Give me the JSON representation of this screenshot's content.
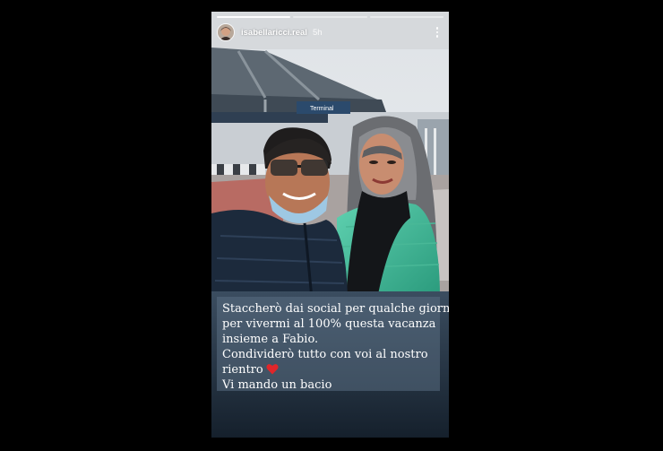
{
  "story": {
    "username": "isabellaricci.real",
    "age": "5h",
    "progress_segments": 3,
    "progress_active": 1,
    "sign_text": "Terminal",
    "caption": {
      "line1": "Staccherò dai social per qualche giorno",
      "line2": "per vivermi al 100% questa vacanza",
      "line3": "insieme a Fabio.",
      "line4": "Condividerò tutto con voi al nostro",
      "line5": "rientro",
      "line6": "Vi mando un bacio"
    },
    "icons": {
      "more": "more-vertical-icon",
      "heart": "red-heart-emoji"
    },
    "colors": {
      "heart": "#e0262a",
      "caption_bg": "#5a6e82"
    }
  }
}
